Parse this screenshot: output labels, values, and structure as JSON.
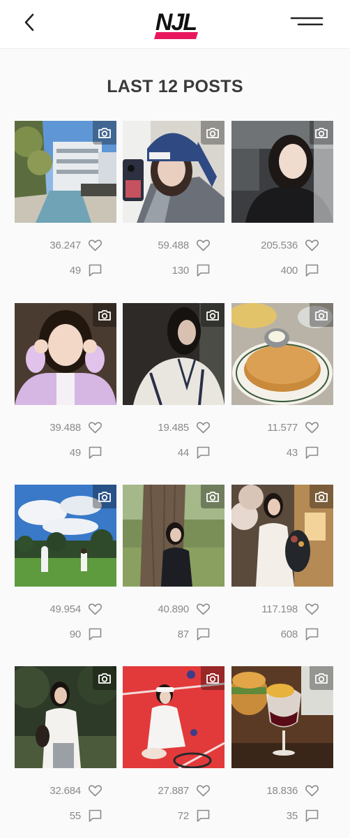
{
  "header": {
    "back_icon": "chevron-left-icon",
    "logo_text": "NJL",
    "logo_accent_color": "#e8175d",
    "menu_icon": "hamburger-icon"
  },
  "section": {
    "title": "LAST 12 POSTS"
  },
  "posts": [
    {
      "likes": "36.247",
      "comments": "49",
      "media_icon": "camera-icon",
      "scene": "building-fountain"
    },
    {
      "likes": "59.488",
      "comments": "130",
      "media_icon": "camera-icon",
      "scene": "girl-blue-beanie-selfie"
    },
    {
      "likes": "205.536",
      "comments": "400",
      "media_icon": "camera-icon",
      "scene": "girl-dark-portrait"
    },
    {
      "likes": "39.488",
      "comments": "49",
      "media_icon": "camera-icon",
      "scene": "girl-pink-cardigan"
    },
    {
      "likes": "19.485",
      "comments": "44",
      "media_icon": "camera-icon",
      "scene": "girl-white-jacket"
    },
    {
      "likes": "11.577",
      "comments": "43",
      "media_icon": "camera-icon",
      "scene": "pancakes"
    },
    {
      "likes": "49.954",
      "comments": "90",
      "media_icon": "camera-icon",
      "scene": "golf-course"
    },
    {
      "likes": "40.890",
      "comments": "87",
      "media_icon": "camera-icon",
      "scene": "girl-by-tree"
    },
    {
      "likes": "117.198",
      "comments": "608",
      "media_icon": "camera-icon",
      "scene": "girl-balloons-flowers"
    },
    {
      "likes": "32.684",
      "comments": "55",
      "media_icon": "camera-icon",
      "scene": "girl-white-shirt-garden"
    },
    {
      "likes": "27.887",
      "comments": "72",
      "media_icon": "camera-icon",
      "scene": "tennis-court"
    },
    {
      "likes": "18.836",
      "comments": "35",
      "media_icon": "camera-icon",
      "scene": "burger-wine"
    }
  ],
  "colors": {
    "stat_text": "#8a8a8a",
    "title_text": "#3a3a3a",
    "background": "#fafafa"
  }
}
